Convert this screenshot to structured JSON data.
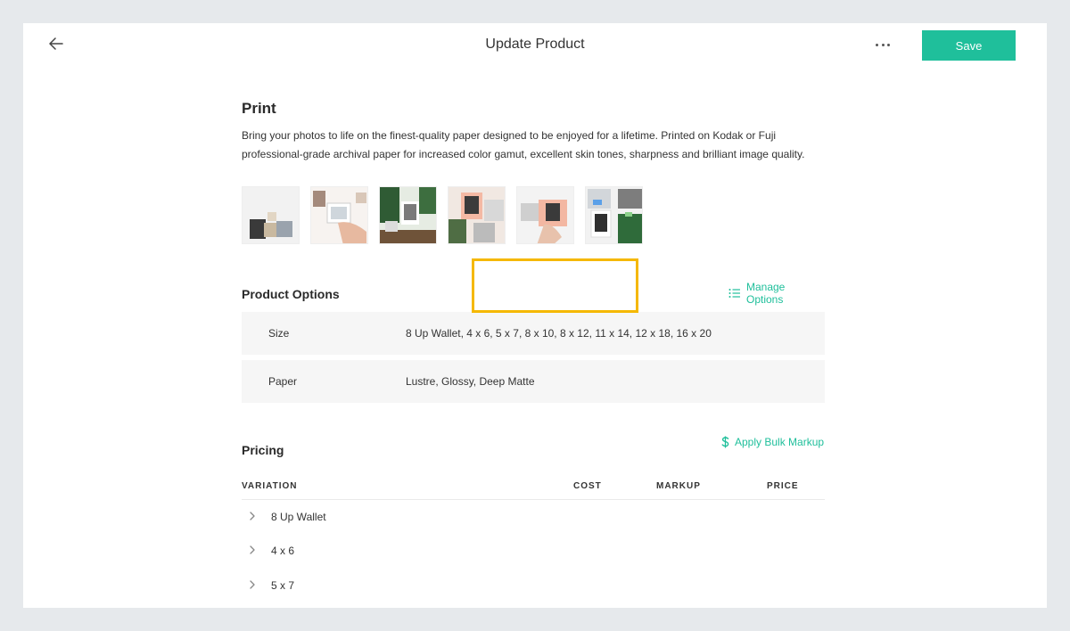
{
  "header": {
    "title": "Update Product",
    "save_label": "Save",
    "icons": {
      "back": "arrow-left-icon",
      "more": "more-horizontal-icon"
    }
  },
  "product": {
    "name": "Print",
    "description": "Bring your photos to life on the finest-quality paper designed to be enjoyed for a lifetime. Printed on Kodak or Fuji professional-grade archival paper for increased color gamut, excellent skin tones, sharpness and brilliant image quality."
  },
  "product_options": {
    "title": "Product Options",
    "manage_label": "Manage Options",
    "options": [
      {
        "name": "Size",
        "values": "8 Up Wallet, 4 x 6, 5 x 7, 8 x 10, 8 x 12, 11 x 14, 12 x 18, 16 x 20"
      },
      {
        "name": "Paper",
        "values": "Lustre, Glossy, Deep Matte"
      }
    ]
  },
  "pricing": {
    "title": "Pricing",
    "bulk_label": "Apply Bulk Markup",
    "columns": [
      "VARIATION",
      "COST",
      "MARKUP",
      "PRICE"
    ],
    "variations": [
      "8 Up Wallet",
      "4 x 6",
      "5 x 7"
    ]
  },
  "colors": {
    "accent": "#1fbf9b",
    "highlight": "#f5b800",
    "background": "#e6e9ec",
    "row_bg": "#f6f6f6"
  }
}
